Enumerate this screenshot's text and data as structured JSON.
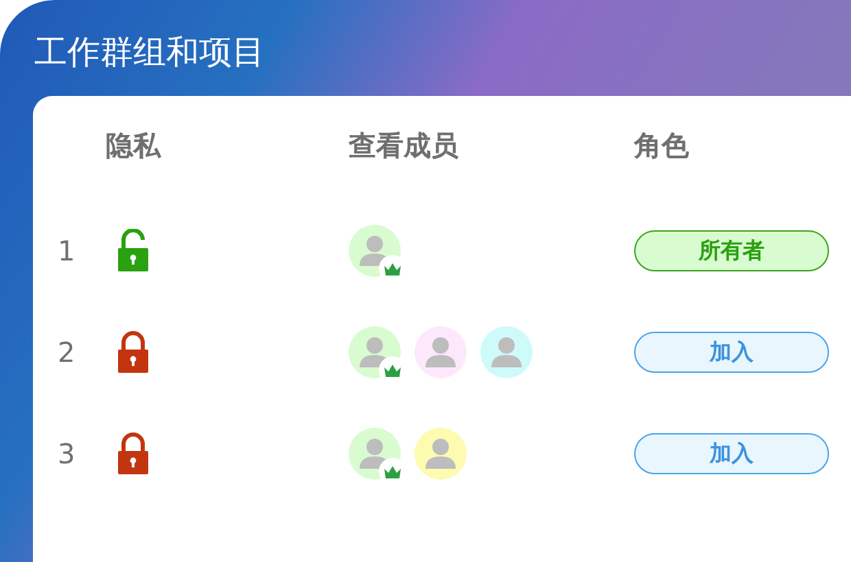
{
  "header": {
    "title": "工作群组和项目"
  },
  "table": {
    "columns": [
      "隐私",
      "查看成员",
      "角色"
    ],
    "rows": [
      {
        "number": "1",
        "locked": false,
        "members": [
          {
            "color": "#d9fbd0",
            "owner": true
          }
        ],
        "role": {
          "kind": "owner",
          "label": "所有者"
        }
      },
      {
        "number": "2",
        "locked": true,
        "members": [
          {
            "color": "#d9fbd0",
            "owner": true
          },
          {
            "color": "#fde8fb",
            "owner": false
          },
          {
            "color": "#cffafa",
            "owner": false
          }
        ],
        "role": {
          "kind": "join",
          "label": "加入"
        }
      },
      {
        "number": "3",
        "locked": true,
        "members": [
          {
            "color": "#d9fbd0",
            "owner": true
          },
          {
            "color": "#fdfbb0",
            "owner": false
          }
        ],
        "role": {
          "kind": "join",
          "label": "加入"
        }
      }
    ]
  }
}
